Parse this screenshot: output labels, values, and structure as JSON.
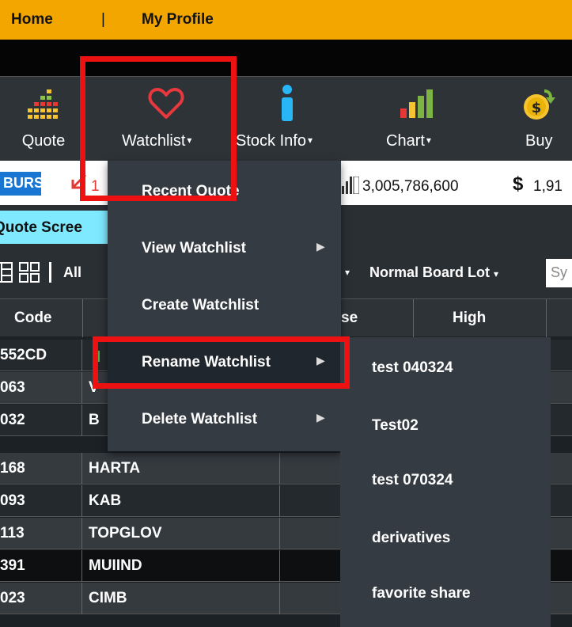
{
  "topnav": {
    "home": "Home",
    "separator": "|",
    "profile": "My Profile"
  },
  "toolbar": {
    "quote": "Quote",
    "watchlist": "Watchlist",
    "stock_info": "Stock Info",
    "chart": "Chart",
    "buy": "Buy",
    "caret": "▾"
  },
  "ticker": {
    "exchange": "BURSA",
    "value_fragment": "1",
    "volume": "3,005,786,600",
    "currency_symbol": "$",
    "amount_fragment": "1,91"
  },
  "quote_screen_tab": "Quote Scree",
  "filters": {
    "all_fragment": "All",
    "board_lot": "Normal Board Lot",
    "search_fragment": "Sy"
  },
  "table": {
    "headers": {
      "code": "Code",
      "close_fragment": "se",
      "high": "High"
    },
    "rows": [
      {
        "code": "552CD",
        "name": ""
      },
      {
        "code": "063",
        "name": "V"
      },
      {
        "code": "032",
        "name": "B"
      },
      {
        "code": "168",
        "name": "HARTA"
      },
      {
        "code": "093",
        "name": "KAB"
      },
      {
        "code": "113",
        "name": "TOPGLOV"
      },
      {
        "code": "391",
        "name": "MUIIND"
      },
      {
        "code": "023",
        "name": "CIMB"
      }
    ]
  },
  "watchlist_menu": {
    "items": [
      {
        "label": "Recent Quote",
        "has_submenu": false
      },
      {
        "label": "View Watchlist",
        "has_submenu": true
      },
      {
        "label": "Create Watchlist",
        "has_submenu": false
      },
      {
        "label": "Rename Watchlist",
        "has_submenu": true
      },
      {
        "label": "Delete Watchlist",
        "has_submenu": true
      }
    ],
    "arrow": "▶"
  },
  "rename_submenu": {
    "items": [
      "test 040324",
      "Test02",
      "test 070324",
      "derivatives",
      "favorite share"
    ]
  },
  "colors": {
    "top_bar": "#f3a500",
    "toolbar_bg": "#2e3338",
    "menu_bg": "#353b42",
    "highlight_box": "#ee1111",
    "heart": "#e8383d",
    "info": "#29b6f6",
    "ticker_badge": "#1976d2"
  },
  "icons": {
    "quote": "bar-grid-icon",
    "watchlist": "heart-icon",
    "stock_info": "info-icon",
    "chart": "bar-chart-icon",
    "buy": "dollar-coin-icon"
  }
}
